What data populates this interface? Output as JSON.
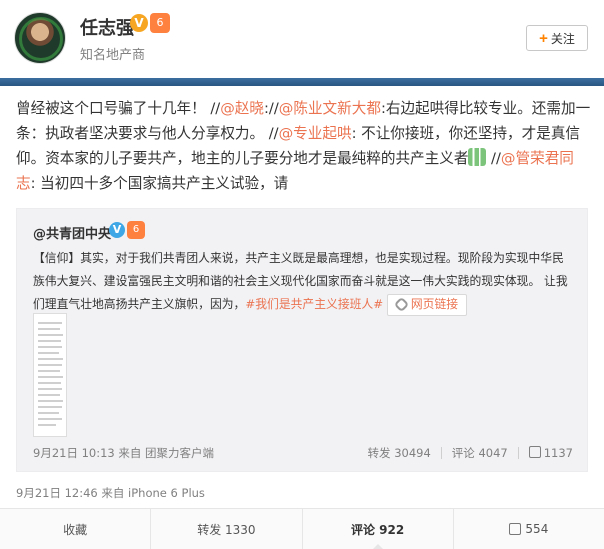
{
  "header": {
    "name": "任志强",
    "verified_badge": "V",
    "vip_badge": "6",
    "subtitle": "知名地产商",
    "follow_plus": "+",
    "follow_label": "关注"
  },
  "post": {
    "text_parts": [
      "曾经被这个口号骗了十几年！ //",
      "@赵晓",
      "://",
      "@陈业文新大都",
      ":右边起哄得比较专业。还需加一条：执政者坚决要求与他人分享权力。 //",
      "@专业起哄",
      ": 不让你接班，你还坚持，才是真信仰。资本家的儿子要共产，地主的儿子要分地才是最纯粹的共产主义者",
      " //",
      "@管荣君同志",
      ": 当初四十多个国家搞共产主义试验，请"
    ],
    "meta": "9月21日 12:46 来自 iPhone 6 Plus"
  },
  "repost": {
    "author": "@共青团中央",
    "verified_badge": "V",
    "vip_badge": "6",
    "text_main": "【信仰】其实，对于我们共青团人来说，共产主义既是最高理想，也是实现过程。现阶段为实现中华民族伟大复兴、建设富强民主文明和谐的社会主义现代化国家而奋斗就是这一伟大实践的现实体现。 让我们理直气壮地高扬共产主义旗帜，因为，",
    "topic": "#我们是共产主义接班人#",
    "web_link": "网页链接",
    "meta": "9月21日 10:13 来自 团聚力客户端",
    "repost_count": "转发 30494",
    "comment_count": "评论 4047",
    "like_count": "1137"
  },
  "actions": {
    "favorite": "收藏",
    "repost": "转发 1330",
    "comment": "评论 922",
    "like": "554"
  },
  "colors": {
    "mention": "#eb7350",
    "divider": "#2f5f8f",
    "repost_bg": "#f2f2f5"
  }
}
